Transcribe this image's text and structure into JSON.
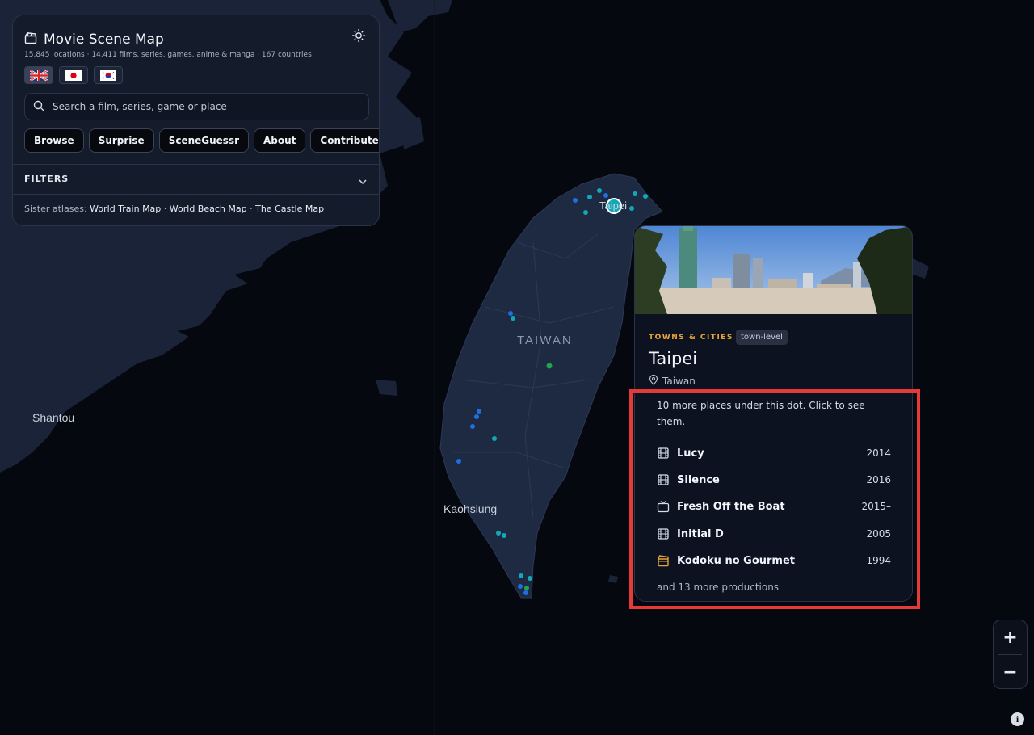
{
  "header": {
    "title": "Movie Scene Map",
    "stats": "15,845 locations · 14,411 films, series, games, anime & manga · 167 countries"
  },
  "search": {
    "placeholder": "Search a film, series, game or place"
  },
  "buttons": [
    "Browse",
    "Surprise",
    "SceneGuessr",
    "About",
    "Contribute"
  ],
  "filters": {
    "label": "FILTERS"
  },
  "sister": {
    "prefix": "Sister atlases:",
    "links": [
      "World Train Map",
      "World Beach Map",
      "The Castle Map"
    ],
    "sep": "·"
  },
  "map_labels": {
    "shantou": "Shantou",
    "taiwan": "TAIWAN",
    "kaohsiung": "Kaohsiung",
    "taipei_partial": "Taipei"
  },
  "card": {
    "category": "TOWNS & CITIES",
    "tag": "town-level",
    "place": "Taipei",
    "country": "Taiwan",
    "more_places": "10 more places under this dot. Click to see them.",
    "productions": [
      {
        "icon": "film-icon",
        "name": "Lucy",
        "year": "2014"
      },
      {
        "icon": "film-icon",
        "name": "Silence",
        "year": "2016"
      },
      {
        "icon": "tv-icon",
        "name": "Fresh Off the Boat",
        "year": "2015–"
      },
      {
        "icon": "film-icon",
        "name": "Initial D",
        "year": "2005"
      },
      {
        "icon": "clapper-icon",
        "name": "Kodoku no Gourmet",
        "year": "1994"
      }
    ],
    "and_more": "and 13 more productions"
  },
  "zoom": {
    "in": "+",
    "out": "−"
  },
  "info": "i",
  "colors": {
    "accent_orange": "#e8a43a",
    "highlight_red": "#e53a3a",
    "dot_blue": "#1f6fe0",
    "dot_cyan": "#13a8b8",
    "dot_green": "#1fa84a"
  }
}
